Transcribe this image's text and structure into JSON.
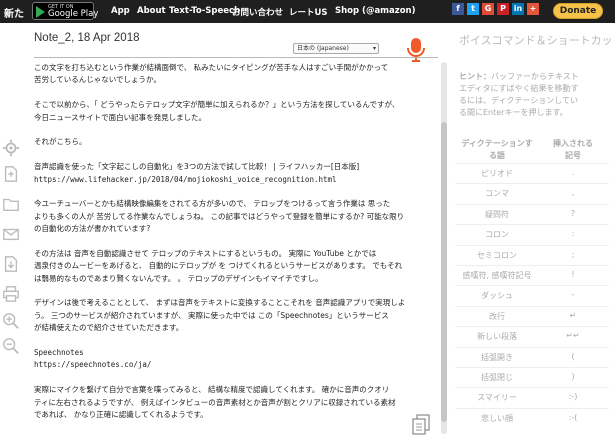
{
  "topbar": {
    "brand": "新た",
    "gplay_small": "GET IT ON",
    "gplay_big": "Google Play",
    "nav": [
      "App",
      "About",
      "Text-To-Speech",
      "お問い合わせ",
      "レートUS",
      "Shop (@amazon)"
    ],
    "socials": [
      {
        "icon": "facebook-icon",
        "glyph": "f",
        "color": "#3b5998"
      },
      {
        "icon": "twitter-icon",
        "glyph": "t",
        "color": "#1da1f2"
      },
      {
        "icon": "google-plus-icon",
        "glyph": "G",
        "color": "#dd4b39"
      },
      {
        "icon": "pinterest-icon",
        "glyph": "P",
        "color": "#cb2027"
      },
      {
        "icon": "linkedin-icon",
        "glyph": "in",
        "color": "#0077b5"
      },
      {
        "icon": "add-icon",
        "glyph": "+",
        "color": "#e0573a"
      }
    ],
    "donate": "Donate"
  },
  "document": {
    "title": "Note_2, 18 Apr 2018",
    "language": "日本の (Japanese)",
    "lines": [
      {
        "t": "この文字を打ち込むという作業が結構面倒で、 私みたいにタイピングが苦手な人はすごい手間がかかって",
        "mono": false
      },
      {
        "t": "苦労しているんじゃないでしょうか。",
        "mono": false
      },
      {
        "t": "",
        "mono": false
      },
      {
        "t": "そこで以前から、「 どうやったらテロップ文字が簡単に加えられるか？」という方法を探しているんですが、",
        "mono": false
      },
      {
        "t": "今日ニュースサイトで面白い記事を発見しました。",
        "mono": false
      },
      {
        "t": "",
        "mono": false
      },
      {
        "t": "それがこちら。",
        "mono": false
      },
      {
        "t": "",
        "mono": false
      },
      {
        "t": "音声認識を使った「文字起こしの自動化」を3つの方法で試して比較！ | ライフハッカー[日本版]",
        "mono": false
      },
      {
        "t": "https://www.lifehacker.jp/2018/04/mojiokoshi_voice_recognition.html",
        "mono": true
      },
      {
        "t": "",
        "mono": false
      },
      {
        "t": "今ユーチューバーとかも結構映像編集をされてる方が多いので、 テロップをつけるって言う作業は 思った",
        "mono": false
      },
      {
        "t": "よりも多くの人が 苦労してる作業なんでしょうね。 この記事ではどうやって登録を簡単にするか? 可能な限り",
        "mono": false
      },
      {
        "t": "の自動化の方法が書かれています?",
        "mono": false
      },
      {
        "t": "",
        "mono": false
      },
      {
        "t": "その方法は 音声を自動認識させて テロップのテキストにするというもの。 実際に YouTube とかでは",
        "mono": false
      },
      {
        "t": "温泉付きのムービーをあげると、 自動的にテロップが を つけてくれるというサービスがあります。 でもそれ",
        "mono": false
      },
      {
        "t": "は翳易的なものであまり賢くないんです。 。 テロップのデザインもイマイチですし。",
        "mono": false
      },
      {
        "t": "",
        "mono": false
      },
      {
        "t": "デザインは後で考えることとして、 まずは音声をテキストに変換することこそれを 音声認識アプリで実現しよ",
        "mono": false
      },
      {
        "t": "う。 三つのサービスが紹介されていますが、 実際に使った中では この「Speechnotes」というサービス",
        "mono": false
      },
      {
        "t": "が結構使えたので紹介させていただきます。",
        "mono": false
      },
      {
        "t": "",
        "mono": false
      },
      {
        "t": "Speechnotes",
        "mono": true
      },
      {
        "t": "https://speechnotes.co/ja/",
        "mono": true
      },
      {
        "t": "",
        "mono": false
      },
      {
        "t": "実際にマイクを繋げて自分で言葉を喋ってみると、 結構な精度で認識してくれます。 確かに音声のクオリ",
        "mono": false
      },
      {
        "t": "ティに左右されるようですが、 例えばインタビューの音声素材とか音声が割とクリアに収録されている素材",
        "mono": false
      },
      {
        "t": "であれば、 かなり正確に認識してくれるようです。",
        "mono": false
      }
    ]
  },
  "panel": {
    "title": "ボイスコマンド＆ショートカット",
    "hint_label": "ヒント：",
    "hint_lines": [
      "バッファーからテキスト",
      "エディタにすばやく結果を移動す",
      "るには、ディクテーションしてい",
      "る間にEnterキーを押します。"
    ],
    "col_phrase": [
      "ディクテーションす",
      "る語"
    ],
    "col_symbol": [
      "挿入される",
      "記号"
    ],
    "rows": [
      {
        "phrase": "ピリオド",
        "symbol": "."
      },
      {
        "phrase": "コンマ",
        "symbol": ","
      },
      {
        "phrase": "疑問符",
        "symbol": "?"
      },
      {
        "phrase": "コロン",
        "symbol": ":"
      },
      {
        "phrase": "セミコロン",
        "symbol": ";"
      },
      {
        "phrase": "感嘆符, 感嘆符記号",
        "symbol": "!"
      },
      {
        "phrase": "ダッシュ",
        "symbol": "-"
      },
      {
        "phrase": "改行",
        "symbol": "↵"
      },
      {
        "phrase": "新しい段落",
        "symbol": "↵↵"
      },
      {
        "phrase": "括弧開き",
        "symbol": "("
      },
      {
        "phrase": "括弧閉じ",
        "symbol": ")"
      },
      {
        "phrase": "スマイリー",
        "symbol": ":-)"
      },
      {
        "phrase": "悲しい顔",
        "symbol": ":-("
      }
    ]
  }
}
